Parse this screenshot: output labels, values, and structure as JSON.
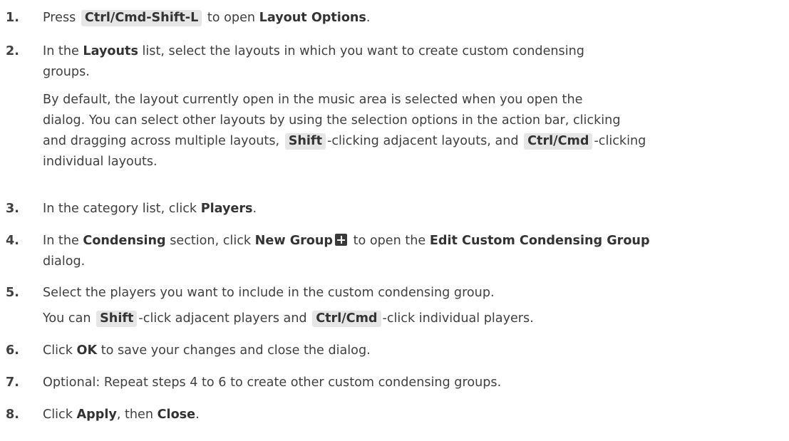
{
  "steps": [
    {
      "number": "1.",
      "pre": "Press ",
      "key": "Ctrl/Cmd-Shift-L",
      "mid": " to open ",
      "bold": "Layout Options",
      "post": "."
    },
    {
      "number": "2.",
      "pre": "In the ",
      "bold": "Layouts",
      "post1": " list, select the layouts in which you want to create custom condensing",
      "line2": "groups.",
      "note": {
        "line1": "By default, the layout currently open in the music area is selected when you open the",
        "line2": "dialog. You can select other layouts by using the selection options in the action bar, clicking",
        "line3_pre": "and dragging across multiple layouts, ",
        "key1": "Shift",
        "line3_mid": "-clicking adjacent layouts, and ",
        "key2": "Ctrl/Cmd",
        "line3_post": "-clicking",
        "line4": "individual layouts."
      }
    },
    {
      "number": "3.",
      "pre": "In the category list, click ",
      "bold": "Players",
      "post": "."
    },
    {
      "number": "4.",
      "pre": "In the ",
      "bold1": "Condensing",
      "mid1": " section, click ",
      "bold2": "New Group",
      "mid2": " to open the ",
      "bold3": "Edit Custom Condensing Group",
      "line2": "dialog."
    },
    {
      "number": "5.",
      "text": "Select the players you want to include in the custom condensing group.",
      "note": {
        "pre": "You can ",
        "key1": "Shift",
        "mid": "-click adjacent players and ",
        "key2": "Ctrl/Cmd",
        "post": "-click individual players."
      }
    },
    {
      "number": "6.",
      "pre": "Click ",
      "bold": "OK",
      "post": " to save your changes and close the dialog."
    },
    {
      "number": "7.",
      "text": "Optional: Repeat steps 4 to 6 to create other custom condensing groups."
    },
    {
      "number": "8.",
      "pre": "Click ",
      "bold1": "Apply",
      "mid": ", then ",
      "bold2": "Close",
      "post": "."
    }
  ],
  "icons": {
    "new_group": "plus-icon"
  },
  "colors": {
    "text": "#404040",
    "key_background": "#e6e6e6"
  }
}
